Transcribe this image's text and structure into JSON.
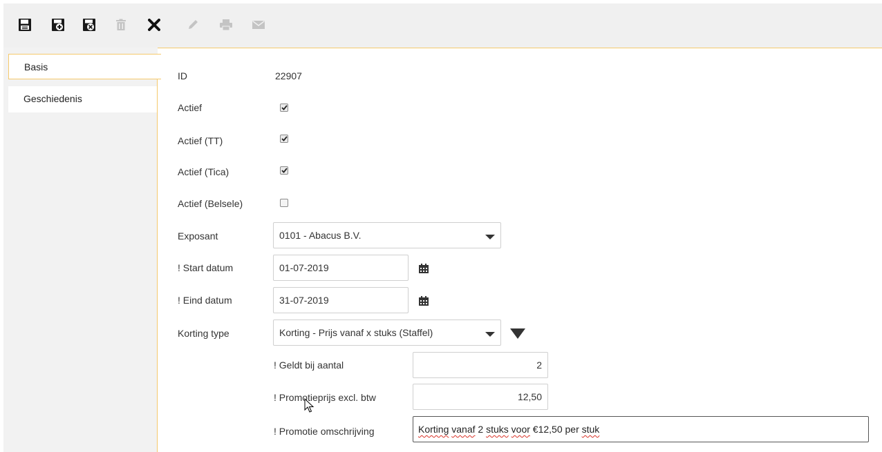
{
  "toolbar": {
    "buttons": [
      {
        "icon": "save-icon",
        "enabled": true
      },
      {
        "icon": "save-new-icon",
        "enabled": true
      },
      {
        "icon": "save-close-icon",
        "enabled": true
      },
      {
        "icon": "trash-icon",
        "enabled": false
      },
      {
        "icon": "close-icon",
        "enabled": true
      },
      {
        "icon": "pencil-icon",
        "enabled": false
      },
      {
        "icon": "print-icon",
        "enabled": false
      },
      {
        "icon": "mail-icon",
        "enabled": false
      }
    ]
  },
  "sidebar": {
    "tabs": [
      {
        "label": "Basis",
        "active": true
      },
      {
        "label": "Geschiedenis",
        "active": false
      }
    ]
  },
  "form": {
    "id_label": "ID",
    "id_value": "22907",
    "actief_label": "Actief",
    "actief_checked": true,
    "actief_tt_label": "Actief (TT)",
    "actief_tt_checked": true,
    "actief_tica_label": "Actief (Tica)",
    "actief_tica_checked": true,
    "actief_belsele_label": "Actief (Belsele)",
    "actief_belsele_checked": false,
    "exposant_label": "Exposant",
    "exposant_value": "0101 - Abacus B.V.",
    "start_label": "! Start datum",
    "start_value": "01-07-2019",
    "eind_label": "! Eind datum",
    "eind_value": "31-07-2019",
    "korting_type_label": "Korting type",
    "korting_type_value": "Korting - Prijs vanaf x stuks (Staffel)",
    "geldt_label": "! Geldt bij aantal",
    "geldt_value": "2",
    "promoprijs_label": "! Promotieprijs excl. btw",
    "promoprijs_value": "12,50",
    "omschrijving_label": "! Promotie omschrijving",
    "omschrijving_parts": [
      "Korting",
      " ",
      "vanaf",
      " 2 ",
      "stuks",
      " ",
      "voor",
      " €12,50 per ",
      "stuk"
    ]
  },
  "colors": {
    "accent": "#f5c96b",
    "toolbar_bg": "#f0f0f0",
    "sidebar_bg": "#f2f2f2",
    "spell_error": "#d93025"
  }
}
